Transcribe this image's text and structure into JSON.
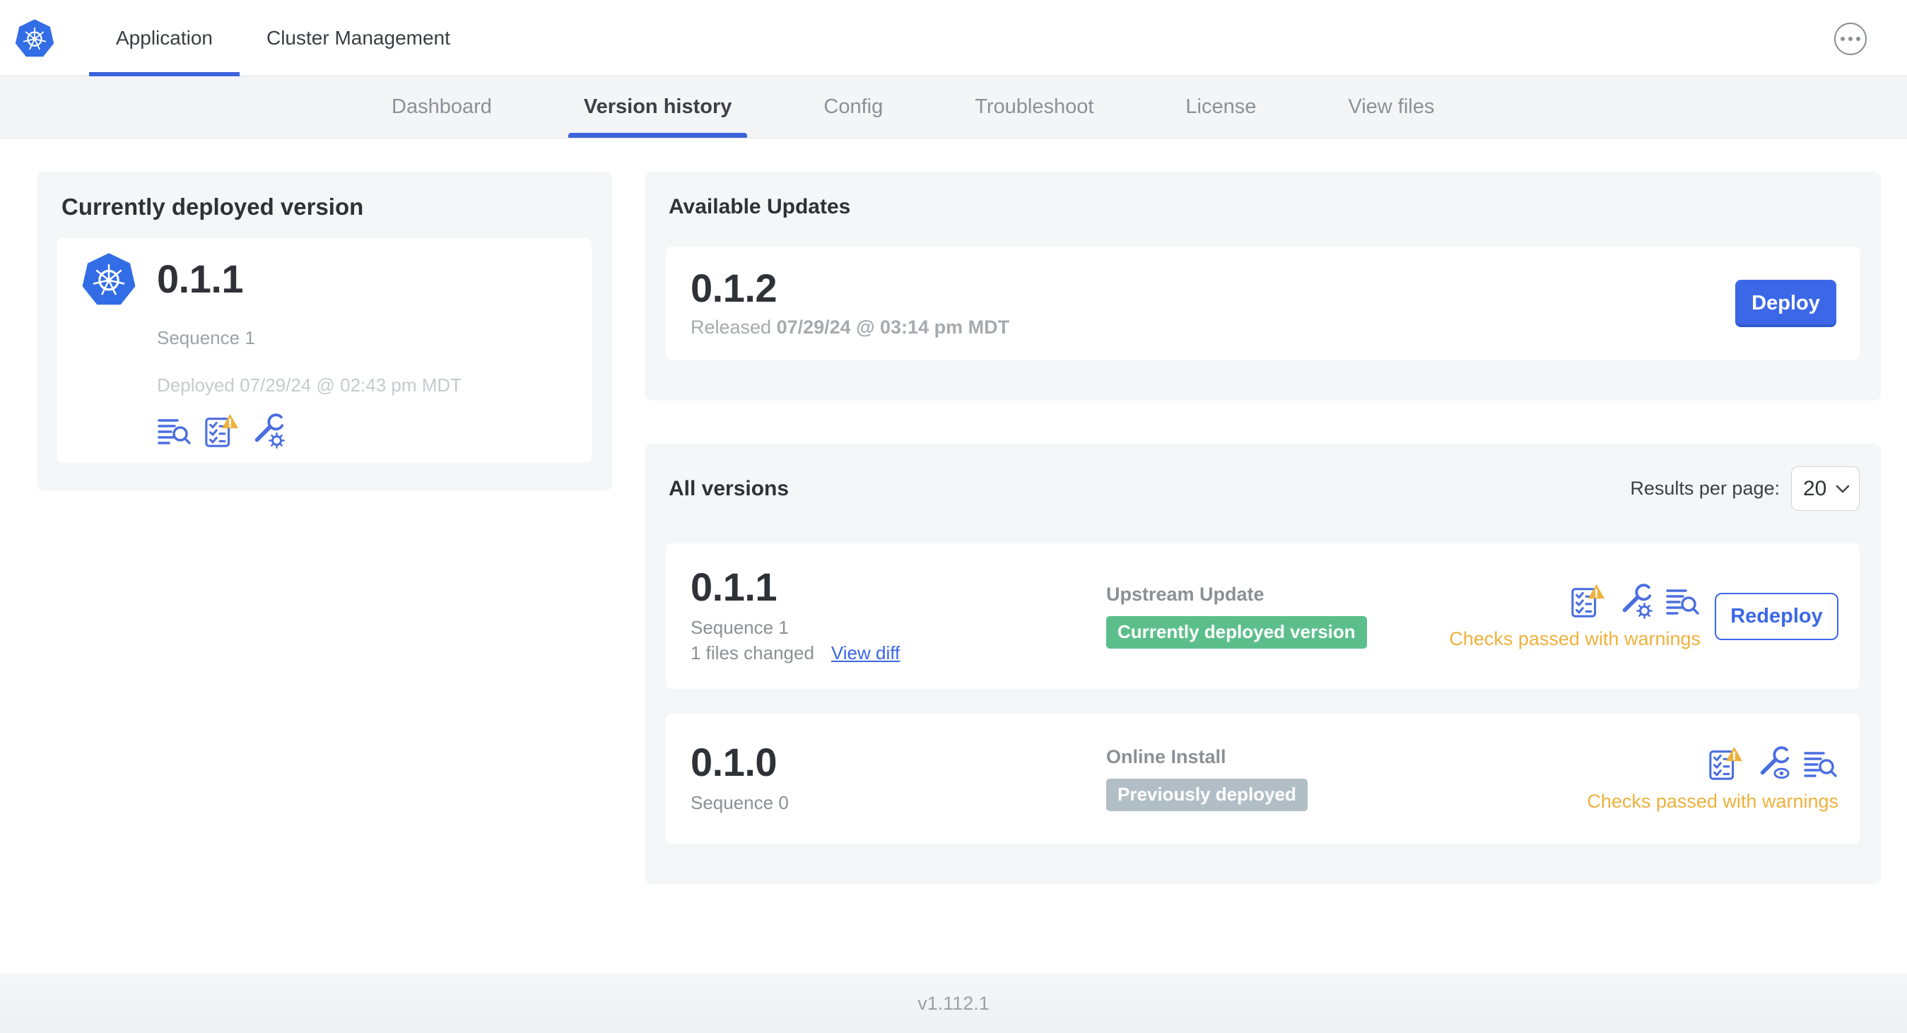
{
  "colors": {
    "accent_blue": "#3c68e7",
    "kubernetes_blue": "#326de6",
    "icon_blue": "#4a6ee0",
    "badge_green": "#5cbf8b",
    "badge_gray": "#b2bec5",
    "warning_amber": "#eeb13c",
    "link_blue": "#3b66e3"
  },
  "icons": {
    "kubernetes-logo": "blue heptagon with white helm wheel",
    "ellipsis-icon": "circled three dots",
    "logs-icon": "text lines with magnifier",
    "preflight-checks-icon": "checklist with warning triangle",
    "edit-config-icon": "wrench with gear",
    "view-config-icon": "wrench with eye",
    "chevron-down-icon": "v chevron"
  },
  "header": {
    "tabs": [
      {
        "label": "Application",
        "active": true
      },
      {
        "label": "Cluster Management",
        "active": false
      }
    ]
  },
  "subnav": {
    "tabs": [
      {
        "label": "Dashboard",
        "active": false
      },
      {
        "label": "Version history",
        "active": true
      },
      {
        "label": "Config",
        "active": false
      },
      {
        "label": "Troubleshoot",
        "active": false
      },
      {
        "label": "License",
        "active": false
      },
      {
        "label": "View files",
        "active": false
      }
    ]
  },
  "deployed_card": {
    "title": "Currently deployed version",
    "version": "0.1.1",
    "sequence": "Sequence 1",
    "deployed_at": "Deployed 07/29/24 @ 02:43 pm MDT"
  },
  "available_updates": {
    "title": "Available Updates",
    "version": "0.1.2",
    "released_prefix": "Released",
    "released_date": "07/29/24 @ 03:14 pm MDT",
    "deploy_label": "Deploy"
  },
  "all_versions": {
    "title": "All versions",
    "results_per_page_label": "Results per page:",
    "results_per_page_value": "20",
    "rows": [
      {
        "version": "0.1.1",
        "sequence": "Sequence 1",
        "files_changed": "1 files changed",
        "view_diff_label": "View diff",
        "source": "Upstream Update",
        "badge_label": "Currently deployed version",
        "badge_type": "green",
        "status": "Checks passed with warnings",
        "action_label": "Redeploy"
      },
      {
        "version": "0.1.0",
        "sequence": "Sequence 0",
        "source": "Online Install",
        "badge_label": "Previously deployed",
        "badge_type": "gray",
        "status": "Checks passed with warnings"
      }
    ]
  },
  "footer": {
    "version": "v1.112.1"
  }
}
